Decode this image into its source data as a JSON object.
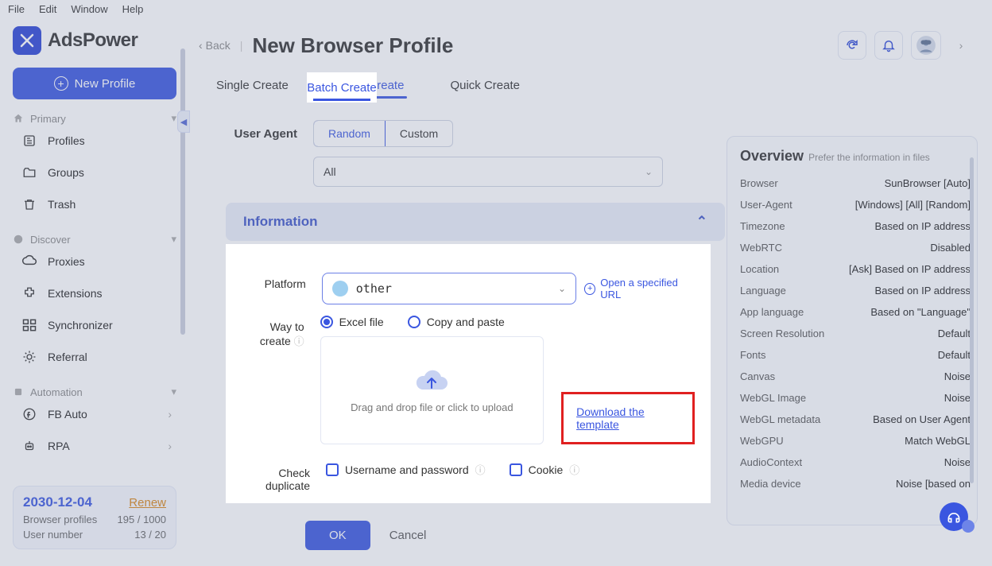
{
  "menubar": [
    "File",
    "Edit",
    "Window",
    "Help"
  ],
  "logo": "AdsPower",
  "new_profile_btn": "New Profile",
  "sidebar": {
    "groups": [
      {
        "title": "Primary",
        "items": [
          {
            "key": "profiles",
            "label": "Profiles"
          },
          {
            "key": "groups",
            "label": "Groups"
          },
          {
            "key": "trash",
            "label": "Trash"
          }
        ]
      },
      {
        "title": "Discover",
        "items": [
          {
            "key": "proxies",
            "label": "Proxies"
          },
          {
            "key": "extensions",
            "label": "Extensions"
          },
          {
            "key": "synchronizer",
            "label": "Synchronizer"
          },
          {
            "key": "referral",
            "label": "Referral"
          }
        ]
      },
      {
        "title": "Automation",
        "items": [
          {
            "key": "fbauto",
            "label": "FB Auto",
            "chev": true
          },
          {
            "key": "rpa",
            "label": "RPA",
            "chev": true
          }
        ]
      }
    ]
  },
  "footer": {
    "date": "2030-12-04",
    "renew": "Renew",
    "lines": [
      {
        "k": "Browser profiles",
        "v": "195 / 1000"
      },
      {
        "k": "User number",
        "v": "13 / 20"
      }
    ]
  },
  "header": {
    "back": "Back",
    "title": "New Browser Profile"
  },
  "tabs": [
    {
      "label": "Single Create",
      "active": false
    },
    {
      "label": "Batch Create",
      "active": true
    },
    {
      "label": "Quick Create",
      "active": false
    }
  ],
  "form": {
    "user_agent_label": "User Agent",
    "ua_random": "Random",
    "ua_custom": "Custom",
    "ua_all": "All",
    "info_header": "Information",
    "platform_label": "Platform",
    "platform_value": "other",
    "open_url": "Open a specified URL",
    "way_label": "Way to create",
    "way_excel": "Excel file",
    "way_copy": "Copy and paste",
    "upload_text": "Drag and drop file or click to upload",
    "download_link": "Download the template",
    "check_dup_label": "Check duplicate",
    "check_userpass": "Username and password",
    "check_cookie": "Cookie",
    "ok": "OK",
    "cancel": "Cancel"
  },
  "overview": {
    "title": "Overview",
    "hint": "Prefer the information in files",
    "rows": [
      {
        "k": "Browser",
        "v": "SunBrowser [Auto]"
      },
      {
        "k": "User-Agent",
        "v": "[Windows] [All] [Random]"
      },
      {
        "k": "Timezone",
        "v": "Based on IP address"
      },
      {
        "k": "WebRTC",
        "v": "Disabled"
      },
      {
        "k": "Location",
        "v": "[Ask] Based on IP address"
      },
      {
        "k": "Language",
        "v": "Based on IP address"
      },
      {
        "k": "App language",
        "v": "Based on \"Language\""
      },
      {
        "k": "Screen Resolution",
        "v": "Default"
      },
      {
        "k": "Fonts",
        "v": "Default"
      },
      {
        "k": "Canvas",
        "v": "Noise"
      },
      {
        "k": "WebGL Image",
        "v": "Noise"
      },
      {
        "k": "WebGL metadata",
        "v": "Based on User Agent"
      },
      {
        "k": "WebGPU",
        "v": "Match WebGL"
      },
      {
        "k": "AudioContext",
        "v": "Noise"
      },
      {
        "k": "Media device",
        "v": "Noise [based on"
      }
    ]
  }
}
